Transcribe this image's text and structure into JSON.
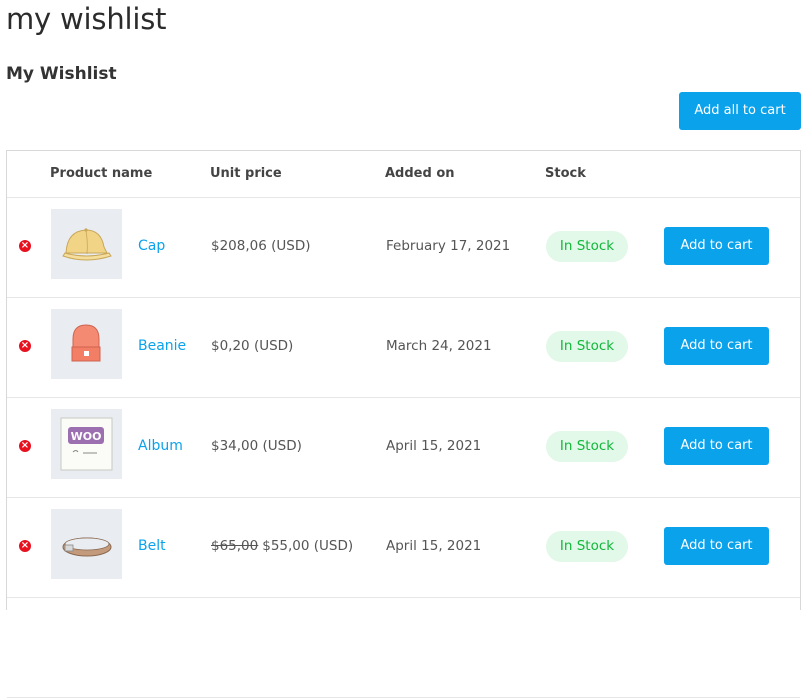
{
  "page": {
    "title": "my wishlist",
    "subtitle": "My Wishlist",
    "add_all_label": "Add all to cart"
  },
  "table": {
    "headers": {
      "product_name": "Product name",
      "unit_price": "Unit price",
      "added_on": "Added on",
      "stock": "Stock"
    },
    "rows": [
      {
        "name": "Cap",
        "price": "$208,06 (USD)",
        "old_price": "",
        "date": "February 17, 2021",
        "stock": "In Stock",
        "cart_label": "Add to cart",
        "remove_glyph": "×",
        "thumb_icon": "cap-icon"
      },
      {
        "name": "Beanie",
        "price": "$0,20 (USD)",
        "old_price": "",
        "date": "March 24, 2021",
        "stock": "In Stock",
        "cart_label": "Add to cart",
        "remove_glyph": "×",
        "thumb_icon": "beanie-icon"
      },
      {
        "name": "Album",
        "price": "$34,00 (USD)",
        "old_price": "",
        "date": "April 15, 2021",
        "stock": "In Stock",
        "cart_label": "Add to cart",
        "remove_glyph": "×",
        "thumb_icon": "album-icon",
        "thumb_text": "WOO"
      },
      {
        "name": "Belt",
        "price": "$55,00 (USD)",
        "old_price": "$65,00",
        "date": "April 15, 2021",
        "stock": "In Stock",
        "cart_label": "Add to cart",
        "remove_glyph": "×",
        "thumb_icon": "belt-icon"
      }
    ]
  },
  "colors": {
    "accent": "#0ba2ec",
    "remove": "#e8101e",
    "stock_bg": "#e2f8e8",
    "stock_text": "#12b83a"
  }
}
